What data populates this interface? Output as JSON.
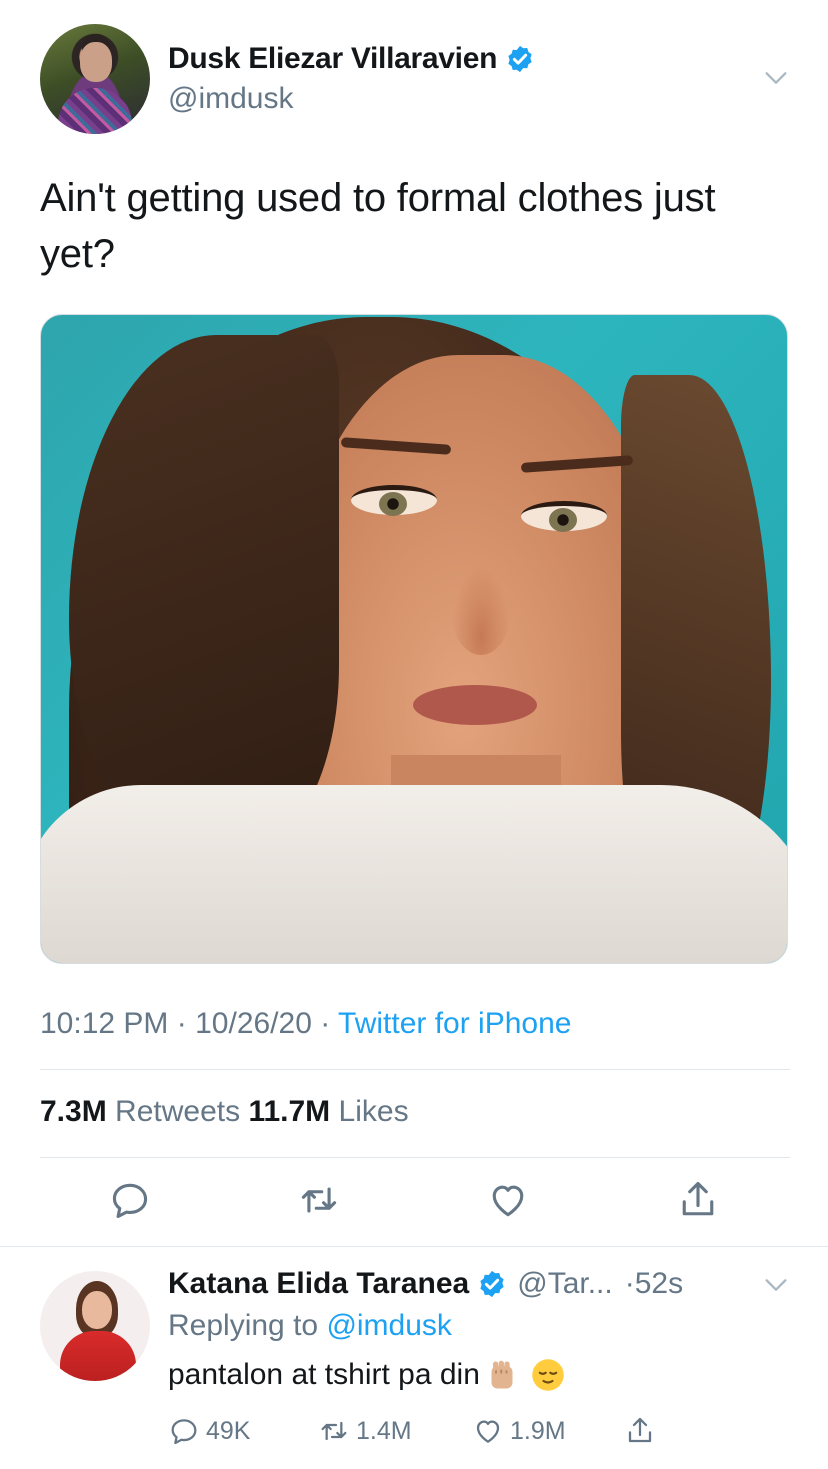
{
  "tweet": {
    "display_name": "Dusk Eliezar Villaravien",
    "handle": "@imdusk",
    "text": "Ain't getting used to formal clothes just yet?",
    "time": "10:12 PM",
    "date": "10/26/20",
    "separator": "·",
    "source": "Twitter for iPhone",
    "retweets_count": "7.3M",
    "retweets_label": "Retweets",
    "likes_count": "11.7M",
    "likes_label": "Likes"
  },
  "reply": {
    "display_name": "Katana Elida Taranea",
    "handle": "@Tar...",
    "time": "·52s",
    "replying_label": "Replying to",
    "replying_to": "@imdusk",
    "text": "pantalon at tshirt pa din",
    "reply_count": "49K",
    "retweet_count": "1.4M",
    "like_count": "1.9M"
  },
  "icons": {
    "verified": "verified-badge-icon",
    "more": "chevron-down-icon",
    "reply": "reply-bubble-icon",
    "retweet": "retweet-icon",
    "like": "heart-icon",
    "share": "share-icon",
    "emoji_1": "raised-fist-emoji",
    "emoji_2": "relieved-face-emoji"
  },
  "colors": {
    "accent": "#1da1f2",
    "secondary_text": "#657786",
    "primary_text": "#14171a"
  }
}
